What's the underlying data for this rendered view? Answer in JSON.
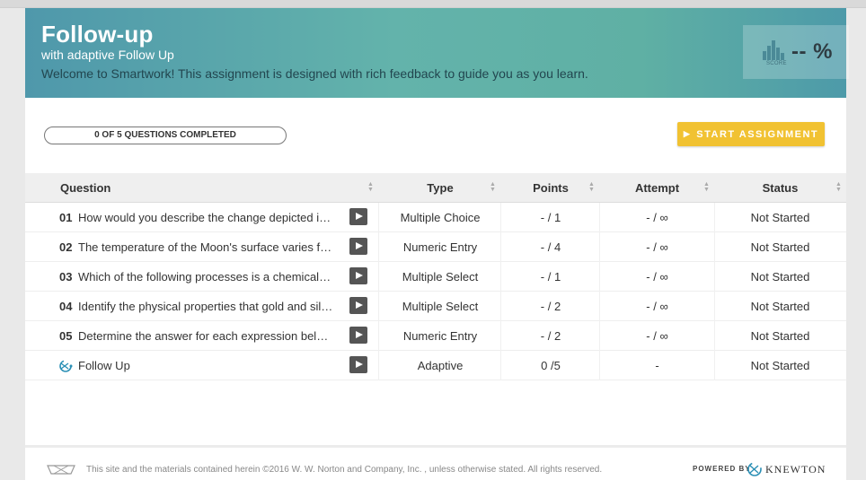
{
  "header": {
    "title": "Follow-up",
    "subtitle": "with adaptive Follow Up",
    "welcome": "Welcome to Smartwork! This assignment is designed with rich feedback to guide you as you learn.",
    "score_caption": "SCORE",
    "score_value": "-- %"
  },
  "progress": {
    "label": "0 OF 5 QUESTIONS COMPLETED",
    "completed": 0,
    "total": 5
  },
  "actions": {
    "start_label": "START ASSIGNMENT",
    "accent_color": "#f1c232"
  },
  "table": {
    "columns": [
      "Question",
      "Type",
      "Points",
      "Attempt",
      "Status"
    ],
    "rows": [
      {
        "num": "01",
        "question": "How would you describe the change depicted in the …",
        "type": "Multiple Choice",
        "points": "- / 1",
        "attempt": "- / ∞",
        "status": "Not Started"
      },
      {
        "num": "02",
        "question": "The temperature of the Moon's surface varies from …",
        "type": "Numeric Entry",
        "points": "- / 4",
        "attempt": "- / ∞",
        "status": "Not Started"
      },
      {
        "num": "03",
        "question": "Which of the following processes is a chemical react…",
        "type": "Multiple Select",
        "points": "- / 1",
        "attempt": "- / ∞",
        "status": "Not Started"
      },
      {
        "num": "04",
        "question": "Identify the physical properties that gold and silver …",
        "type": "Multiple Select",
        "points": "- / 2",
        "attempt": "- / ∞",
        "status": "Not Started"
      },
      {
        "num": "05",
        "question": "Determine the answer for each expression below an…",
        "type": "Numeric Entry",
        "points": "- / 2",
        "attempt": "- / ∞",
        "status": "Not Started"
      }
    ],
    "followup": {
      "question": "Follow Up",
      "type": "Adaptive",
      "points": "0 /5",
      "attempt": "-",
      "status": "Not Started"
    }
  },
  "footer": {
    "copyright": "This site and the materials contained herein ©2016 W. W. Norton and Company, Inc. , unless otherwise stated. All rights reserved.",
    "powered_by": "POWERED BY",
    "brand": "KNEWTON"
  }
}
